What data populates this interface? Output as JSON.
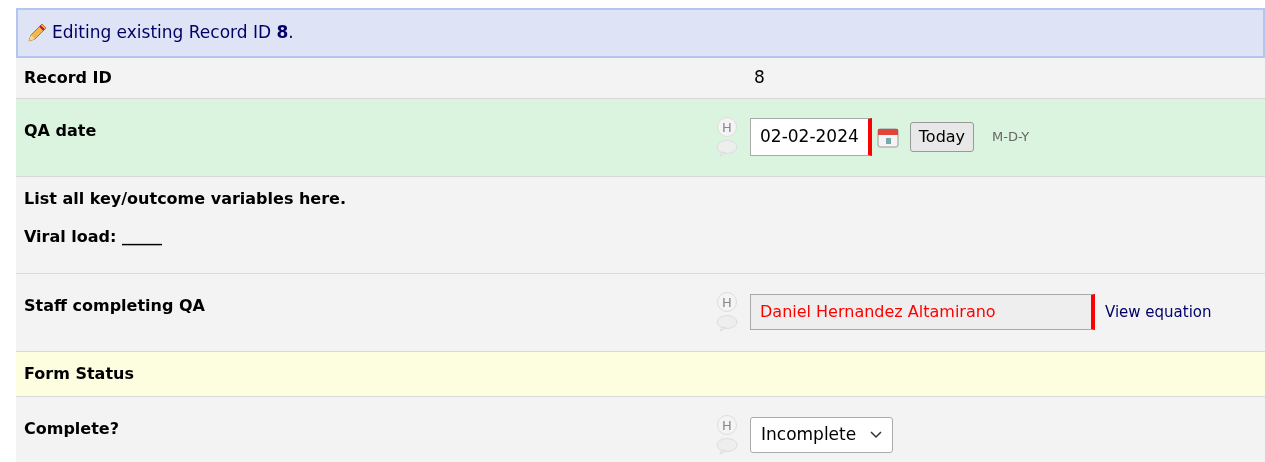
{
  "header": {
    "text": "Editing existing Record ID **8**."
  },
  "rows": [
    {
      "kind": "value",
      "label": "Record ID",
      "value": "8"
    },
    {
      "kind": "date",
      "label": "QA date",
      "highlighted": true,
      "history_mark": "H",
      "value": "02-02-2024",
      "required": true,
      "today_button": "Today",
      "format": "M-D-Y"
    },
    {
      "kind": "descriptive",
      "lines": [
        "List all key/outcome variables here.",
        "Viral load: _____"
      ]
    },
    {
      "kind": "calc",
      "label": "Staff completing QA",
      "highlighted": false,
      "history_mark": "H",
      "value": "Daniel Hernandez Altamirano",
      "required": true,
      "link": "View equation"
    },
    {
      "kind": "section",
      "label": "Form Status"
    },
    {
      "kind": "select",
      "label": "Complete?",
      "highlighted": false,
      "history_mark": "H",
      "value": "Incomplete"
    }
  ]
}
